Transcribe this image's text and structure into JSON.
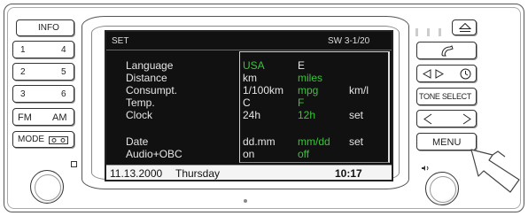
{
  "left_buttons": {
    "info": "INFO",
    "p1": "1",
    "p4": "4",
    "p2": "2",
    "p5": "5",
    "p3": "3",
    "p6": "6",
    "fm": "FM",
    "am": "AM",
    "mode": "MODE"
  },
  "right_buttons": {
    "eject": "eject-icon",
    "phone": "phone-icon",
    "nav": "seek-clock-icon",
    "tone": "TONE SELECT",
    "seek": "left-right-arrows-icon",
    "menu": "MENU"
  },
  "screen": {
    "header_left": "SET",
    "header_right": "SW 3-1/20",
    "rows": [
      {
        "label": "Language",
        "opt1": "USA",
        "opt2": "E",
        "opt3": "",
        "opt1_selected": true,
        "opt2_selected": false
      },
      {
        "label": "Distance",
        "opt1": "km",
        "opt2": "miles",
        "opt3": "",
        "opt1_selected": false,
        "opt2_selected": true
      },
      {
        "label": "Consumpt.",
        "opt1": "1/100km",
        "opt2": "mpg",
        "opt3": "km/l",
        "opt1_selected": false,
        "opt2_selected": true
      },
      {
        "label": "Temp.",
        "opt1": "C",
        "opt2": "F",
        "opt3": "",
        "opt1_selected": false,
        "opt2_selected": true
      },
      {
        "label": "Clock",
        "opt1": "24h",
        "opt2": "12h",
        "opt3": "set",
        "opt1_selected": false,
        "opt2_selected": true
      },
      {
        "label": "Date",
        "opt1": "dd.mm",
        "opt2": "mm/dd",
        "opt3": "set",
        "opt1_selected": false,
        "opt2_selected": true
      },
      {
        "label": "Audio+OBC",
        "opt1": "on",
        "opt2": "off",
        "opt3": "",
        "opt1_selected": false,
        "opt2_selected": true
      }
    ],
    "status_date": "11.13.2000",
    "status_day": "Thursday",
    "status_time": "10:17"
  },
  "colors": {
    "screen_bg": "#111111",
    "text_white": "#e6e6e6",
    "text_green": "#3bc43b",
    "selected_highlight": "#3bc43b"
  }
}
